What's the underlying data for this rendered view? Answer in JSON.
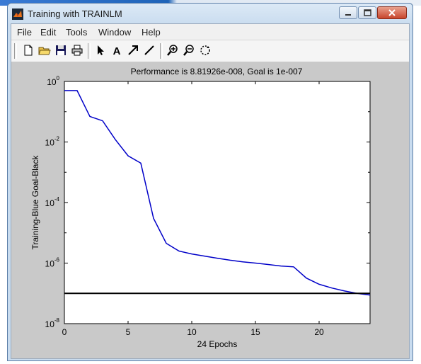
{
  "window": {
    "title": "Training with TRAINLM"
  },
  "menu": {
    "items": [
      "File",
      "Edit",
      "Tools",
      "Window",
      "Help"
    ]
  },
  "toolbar": {
    "icons": [
      "new-file-icon",
      "open-folder-icon",
      "save-icon",
      "print-icon",
      "select-arrow-icon",
      "insert-text-icon",
      "insert-arrow-icon",
      "insert-line-icon",
      "zoom-in-icon",
      "zoom-out-icon",
      "rotate-icon"
    ]
  },
  "chart_data": {
    "type": "line",
    "title": "Performance is 8.81926e-008, Goal is 1e-007",
    "xlabel": "24 Epochs",
    "ylabel": "Training-Blue  Goal-Black",
    "xlim": [
      0,
      24
    ],
    "ylim": [
      1e-08,
      1
    ],
    "yscale": "log",
    "xticks": [
      "0",
      "5",
      "10",
      "15",
      "20"
    ],
    "yticks": [
      {
        "base": "10",
        "exp": "0"
      },
      {
        "base": "10",
        "exp": "-2"
      },
      {
        "base": "10",
        "exp": "-4"
      },
      {
        "base": "10",
        "exp": "-6"
      },
      {
        "base": "10",
        "exp": "-8"
      }
    ],
    "series": [
      {
        "color": "#0000c8",
        "x": [
          0,
          1,
          2,
          3,
          4,
          5,
          6,
          7,
          8,
          9,
          10,
          11,
          12,
          13,
          14,
          15,
          16,
          17,
          18,
          19,
          20,
          21,
          22,
          23,
          24
        ],
        "y": [
          0.5,
          0.5,
          0.07,
          0.05,
          0.012,
          0.0035,
          0.002,
          3e-05,
          4.5e-06,
          2.5e-06,
          2e-06,
          1.7e-06,
          1.45e-06,
          1.25e-06,
          1.1e-06,
          1e-06,
          9e-07,
          8e-07,
          7.5e-07,
          3.2e-07,
          2e-07,
          1.5e-07,
          1.2e-07,
          1e-07,
          8.81926e-08
        ]
      },
      {
        "color": "#000000",
        "x": [
          0,
          24
        ],
        "y": [
          1e-07,
          1e-07
        ]
      }
    ],
    "grid": false
  }
}
